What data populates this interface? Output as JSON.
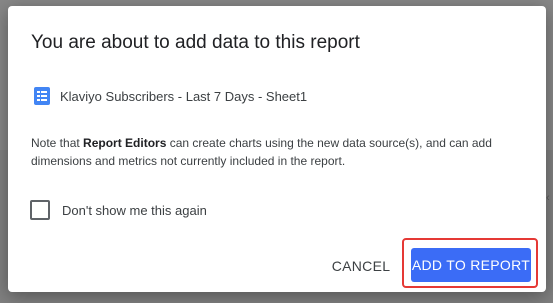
{
  "dialog": {
    "title": "You are about to add data to this report",
    "source": {
      "icon": "spreadsheet-icon",
      "name": "Klaviyo Subscribers - Last 7 Days - Sheet1"
    },
    "note": {
      "prefix": "Note that ",
      "emphasis": "Report Editors",
      "suffix": " can create charts using the new data source(s), and can add dimensions and metrics not currently included in the report."
    },
    "checkbox": {
      "label": "Don't show me this again",
      "checked": false
    },
    "buttons": {
      "cancel": "CANCEL",
      "add": "ADD TO REPORT"
    }
  },
  "colors": {
    "primary_button": "#3b6cf6",
    "highlight": "#e53935",
    "sheet_icon": "#4285f4"
  }
}
